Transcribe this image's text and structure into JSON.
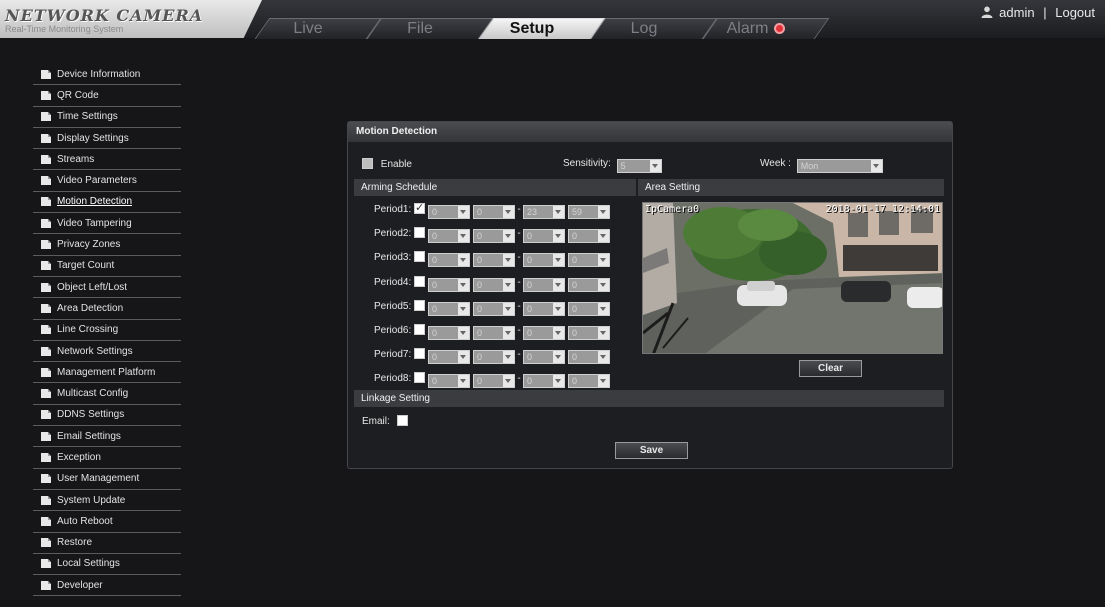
{
  "app": {
    "logo_title": "NETWORK CAMERA",
    "logo_subtitle": "Real-Time Monitoring System"
  },
  "nav": {
    "tabs": [
      "Live",
      "File",
      "Setup",
      "Log",
      "Alarm"
    ],
    "active_tab": "Setup"
  },
  "user": {
    "name": "admin",
    "separator": "|",
    "logout": "Logout"
  },
  "sidebar": {
    "active": "Motion Detection",
    "items": [
      "Device Information",
      "QR Code",
      "Time Settings",
      "Display Settings",
      "Streams",
      "Video Parameters",
      "Motion Detection",
      "Video Tampering",
      "Privacy Zones",
      "Target Count",
      "Object Left/Lost",
      "Area Detection",
      "Line Crossing",
      "Network Settings",
      "Management Platform",
      "Multicast Config",
      "DDNS Settings",
      "Email Settings",
      "Exception",
      "User Management",
      "System Update",
      "Auto Reboot",
      "Restore",
      "Local Settings",
      "Developer"
    ]
  },
  "panel": {
    "title": "Motion Detection",
    "enable_label": "Enable",
    "sensitivity_label": "Sensitivity:",
    "sensitivity_value": "5",
    "week_label": "Week :",
    "week_value": "Mon",
    "arming_schedule_title": "Arming Schedule",
    "area_setting_title": "Area Setting",
    "periods": [
      {
        "label": "Period1:",
        "checked": true,
        "values": [
          "0",
          "0",
          "23",
          "59"
        ]
      },
      {
        "label": "Period2:",
        "checked": false,
        "values": [
          "0",
          "0",
          "0",
          "0"
        ]
      },
      {
        "label": "Period3:",
        "checked": false,
        "values": [
          "0",
          "0",
          "0",
          "0"
        ]
      },
      {
        "label": "Period4:",
        "checked": false,
        "values": [
          "0",
          "0",
          "0",
          "0"
        ]
      },
      {
        "label": "Period5:",
        "checked": false,
        "values": [
          "0",
          "0",
          "0",
          "0"
        ]
      },
      {
        "label": "Period6:",
        "checked": false,
        "values": [
          "0",
          "0",
          "0",
          "0"
        ]
      },
      {
        "label": "Period7:",
        "checked": false,
        "values": [
          "0",
          "0",
          "0",
          "0"
        ]
      },
      {
        "label": "Period8:",
        "checked": false,
        "values": [
          "0",
          "0",
          "0",
          "0"
        ]
      }
    ],
    "period_dash": "-",
    "video_osd_name": "IpCamera0",
    "video_osd_time": "2018-01-17 12:14:01",
    "clear_button": "Clear",
    "linkage_title": "Linkage Setting",
    "email_label": "Email:",
    "save_button": "Save"
  },
  "colors": {
    "background": "#161619",
    "active_tab": "#f0f0f0",
    "alarm": "#e2323a",
    "panel_header": "#3a3c40"
  },
  "icons": {
    "user": "user-icon",
    "sidebar_item": "document-icon",
    "alarm": "alarm-indicator-icon",
    "dropdown": "chevron-down-icon"
  }
}
